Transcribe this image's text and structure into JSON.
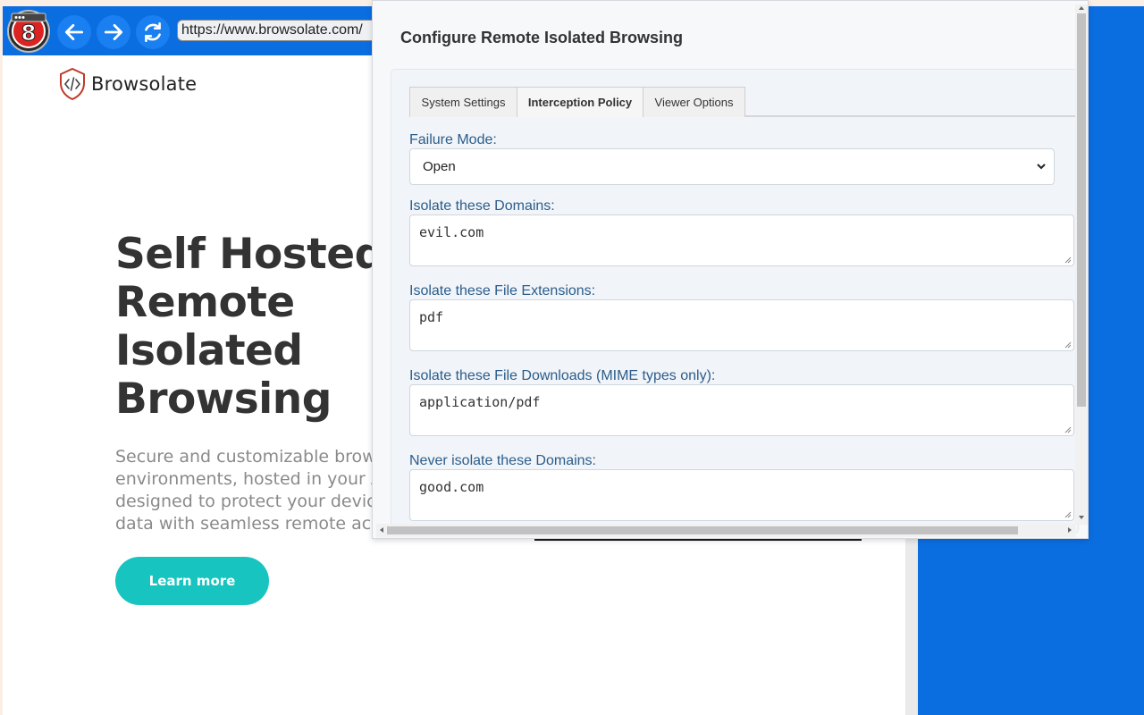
{
  "browser": {
    "badge_number": "8",
    "url": "https://www.browsolate.com/",
    "icons": [
      "back-arrow-icon",
      "forward-arrow-icon",
      "reload-icon"
    ]
  },
  "site": {
    "brand_name": "Browsolate",
    "hero_title_lines": [
      "Self Hosted.",
      "Remote",
      "Isolated",
      "Browsing"
    ],
    "hero_subtitle_lines": [
      "Secure and customizable brow",
      "environments, hosted in your A",
      "designed to protect your device",
      "data with seamless remote acc"
    ],
    "cta_label": "Learn more",
    "colors": {
      "accent": "#17c4bf",
      "brand_blue": "#0b6ee0"
    }
  },
  "popup": {
    "title": "Configure Remote Isolated Browsing",
    "tabs": [
      {
        "label": "System Settings",
        "active": false
      },
      {
        "label": "Interception Policy",
        "active": true
      },
      {
        "label": "Viewer Options",
        "active": false
      }
    ],
    "failure_mode": {
      "label": "Failure Mode:",
      "value": "Open"
    },
    "isolate_domains": {
      "label": "Isolate these Domains:",
      "value": "evil.com"
    },
    "isolate_extensions": {
      "label": "Isolate these File Extensions:",
      "value": "pdf"
    },
    "isolate_downloads": {
      "label": "Isolate these File Downloads (MIME types only):",
      "value": "application/pdf"
    },
    "never_isolate_domains": {
      "label": "Never isolate these Domains:",
      "value": "good.com"
    }
  }
}
